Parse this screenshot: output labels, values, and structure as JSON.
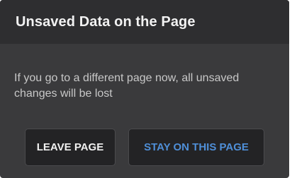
{
  "dialog": {
    "title": "Unsaved Data on the Page",
    "message": "If you go to a different page now, all unsaved changes will be lost",
    "buttons": {
      "leave_label": "LEAVE PAGE",
      "stay_label": "STAY ON THIS PAGE"
    },
    "colors": {
      "background": "#3a3a3c",
      "header": "#2e2e30",
      "button_bg": "#232325",
      "stay_accent": "#4f8fd8"
    }
  }
}
